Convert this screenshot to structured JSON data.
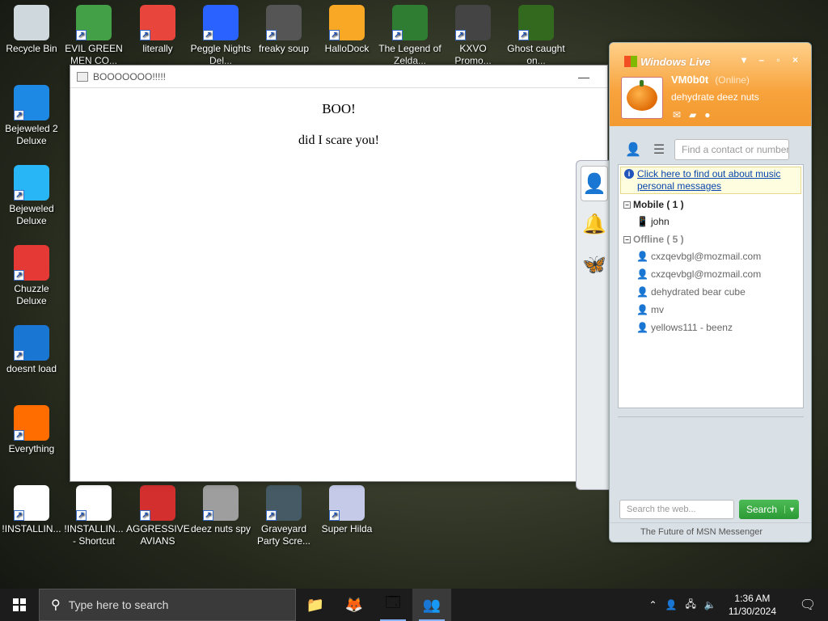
{
  "desktop": {
    "icons": [
      {
        "label": "Recycle Bin",
        "icon": "recycle-bin-icon",
        "color": "#cfd8dc"
      },
      {
        "label": "EVIL GREEN MEN CO...",
        "icon": "green-men-icon",
        "color": "#43a047"
      },
      {
        "label": "literally",
        "icon": "chrome-icon",
        "color": "#e8453c"
      },
      {
        "label": "Peggle Nights Del...",
        "icon": "peggle-icon",
        "color": "#2962ff"
      },
      {
        "label": "freaky soup",
        "icon": "video-file-icon",
        "color": "#555555"
      },
      {
        "label": "HalloDock",
        "icon": "shield-icon",
        "color": "#f9a825"
      },
      {
        "label": "The Legend of Zelda...",
        "icon": "zelda-icon",
        "color": "#2e7d32"
      },
      {
        "label": "KXVO Promo...",
        "icon": "video-file-icon",
        "color": "#444444"
      },
      {
        "label": "Ghost caught on...",
        "icon": "video-file-icon",
        "color": "#33691e"
      },
      {
        "label": "Bejeweled 2 Deluxe",
        "icon": "bejeweled2-icon",
        "color": "#1e88e5"
      },
      {
        "label": "Bejeweled Deluxe",
        "icon": "diamond-icon",
        "color": "#29b6f6"
      },
      {
        "label": "Chuzzle Deluxe",
        "icon": "chuzzle-icon",
        "color": "#e53935"
      },
      {
        "label": "doesnt load",
        "icon": "thunderbird-icon",
        "color": "#1976d2"
      },
      {
        "label": "Everything",
        "icon": "magnifier-icon",
        "color": "#ff6d00"
      },
      {
        "label": "!INSTALLIN...",
        "icon": "document-icon",
        "color": "#ffffff"
      },
      {
        "label": "!INSTALLIN... - Shortcut",
        "icon": "document-icon",
        "color": "#ffffff"
      },
      {
        "label": "AGGRESSIVE AVIANS",
        "icon": "angry-bird-icon",
        "color": "#d32f2f"
      },
      {
        "label": "deez nuts spy",
        "icon": "windows-stack-icon",
        "color": "#9e9e9e"
      },
      {
        "label": "Graveyard Party Scre...",
        "icon": "graveyard-icon",
        "color": "#455a64"
      },
      {
        "label": "Super Hilda",
        "icon": "super-hilda-icon",
        "color": "#c5cae9"
      }
    ]
  },
  "boo_window": {
    "title": "BOOOOOOO!!!!!",
    "minimize": "—",
    "heading": "BOO!",
    "body": "did I scare you!"
  },
  "messenger": {
    "title": "Windows Live",
    "controls": "▾ – ▫ ×",
    "username": "VM0b0t",
    "status": "(Online)",
    "personal_message": "dehydrate deez nuts",
    "find_placeholder": "Find a contact or number...",
    "info_link": "Click here to find out about music personal messages",
    "groups": [
      {
        "label": "Mobile ( 1 )",
        "contacts": [
          {
            "name": "john"
          }
        ]
      },
      {
        "label": "Offline ( 5 )",
        "contacts": [
          {
            "name": "cxzqevbgl@mozmail.com"
          },
          {
            "name": "cxzqevbgl@mozmail.com"
          },
          {
            "name": "dehydrated bear cube"
          },
          {
            "name": "mv"
          },
          {
            "name": "yellows111 - beenz"
          }
        ]
      }
    ],
    "web_search_placeholder": "Search the web...",
    "search_button": "Search",
    "footer": "The Future of MSN Messenger"
  },
  "taskbar": {
    "search_placeholder": "Type here to search",
    "apps": [
      {
        "icon": "file-explorer-icon",
        "glyph": "📁"
      },
      {
        "icon": "firefox-icon",
        "glyph": "🦊"
      },
      {
        "icon": "window-app-icon",
        "glyph": "🗔"
      },
      {
        "icon": "messenger-icon",
        "glyph": "👥"
      }
    ],
    "time": "1:36 AM",
    "date": "11/30/2024"
  }
}
